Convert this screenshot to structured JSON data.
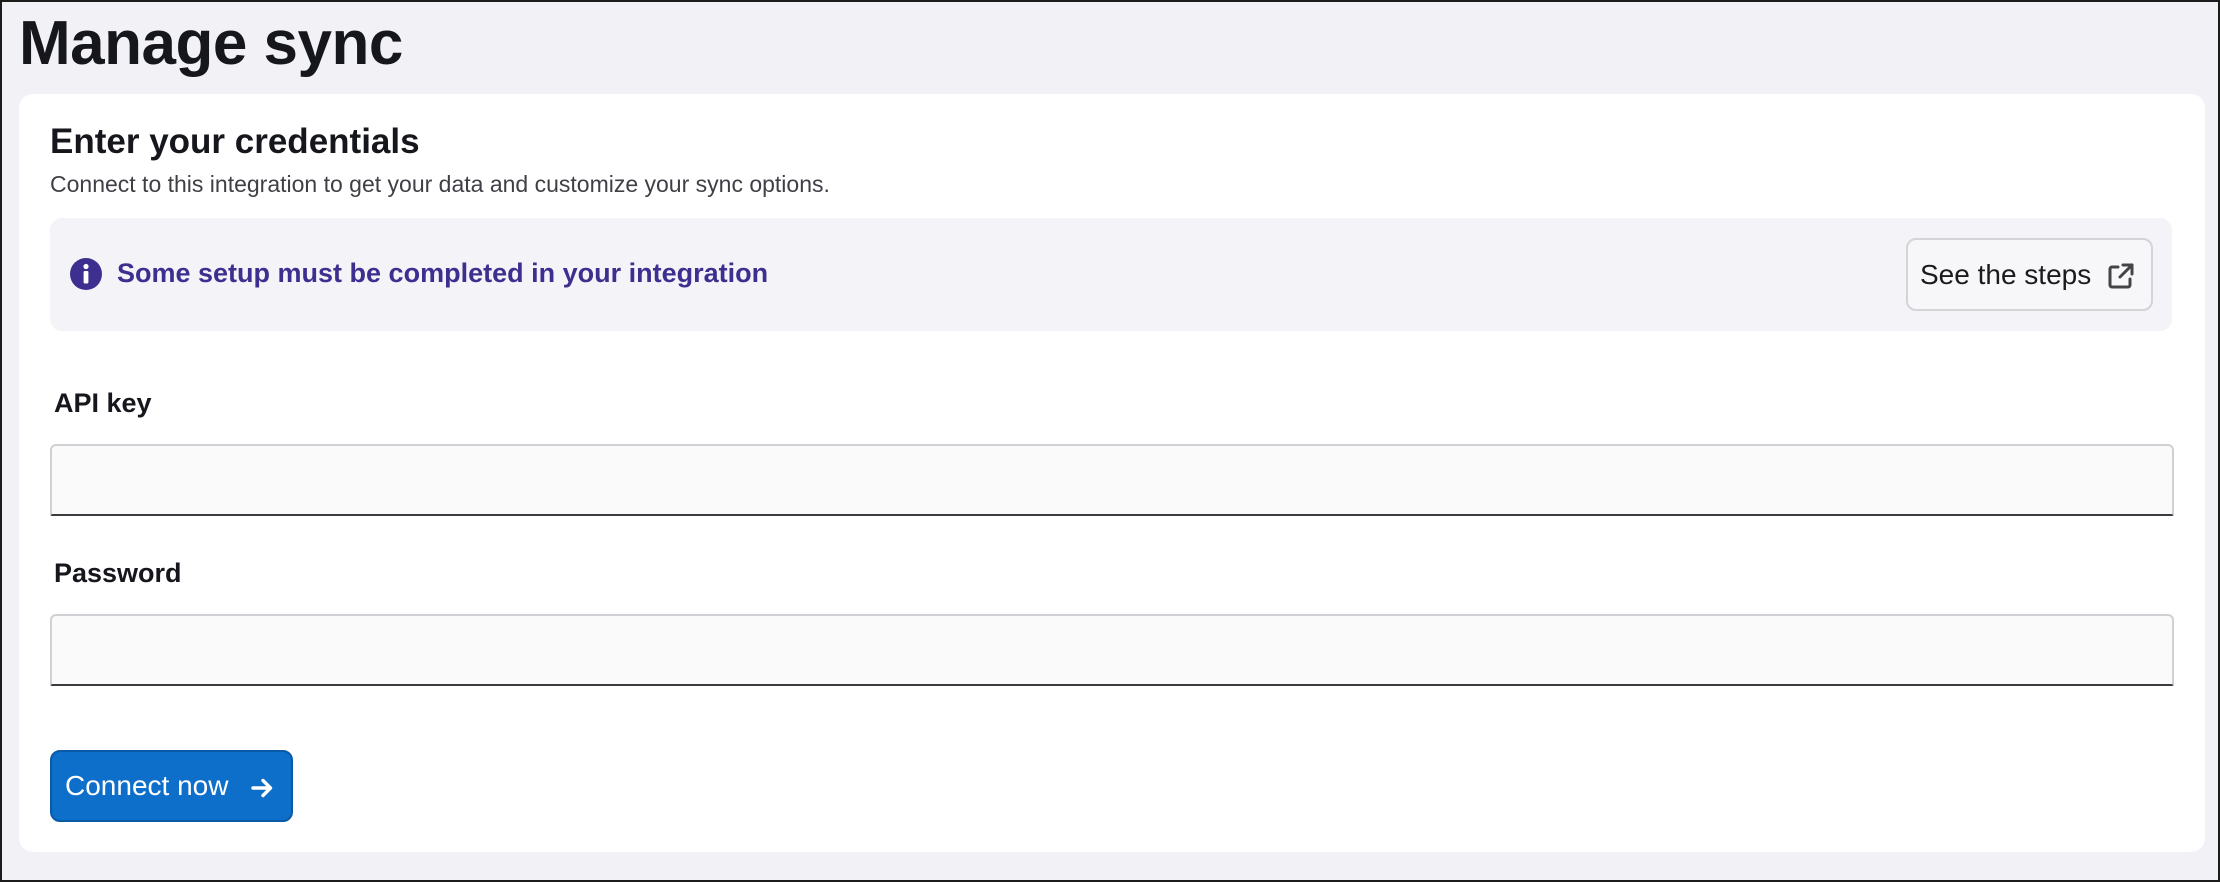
{
  "page": {
    "title": "Manage sync"
  },
  "credentials": {
    "title": "Enter your credentials",
    "subtitle": "Connect to this integration to get your data and customize your sync options."
  },
  "banner": {
    "icon": "info-icon",
    "message": "Some setup must be completed in your integration",
    "button_label": "See the steps",
    "button_icon": "external-link-icon",
    "text_color": "#3d2f8f"
  },
  "form": {
    "api_key": {
      "label": "API key",
      "value": "",
      "placeholder": ""
    },
    "password": {
      "label": "Password",
      "value": "",
      "placeholder": ""
    }
  },
  "actions": {
    "connect_label": "Connect now",
    "connect_icon": "arrow-right-icon",
    "accent_color": "#0d6fca"
  }
}
